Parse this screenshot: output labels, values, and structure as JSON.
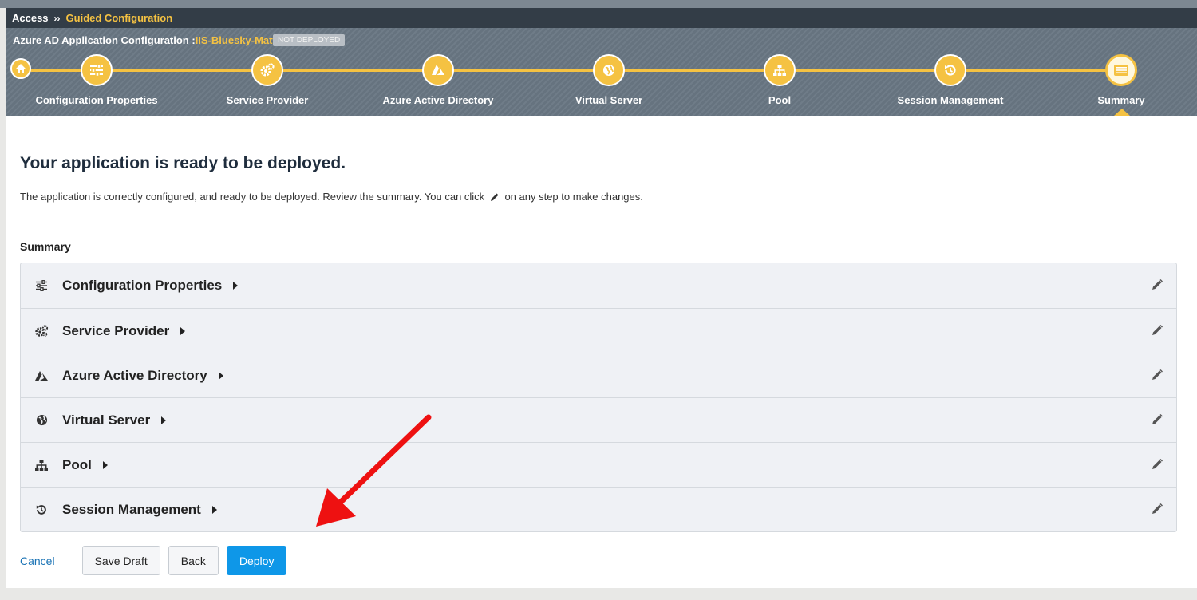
{
  "breadcrumb": {
    "root": "Access",
    "separator": "››",
    "current": "Guided Configuration"
  },
  "wizard": {
    "title_prefix": "Azure AD Application Configuration :",
    "app_name": "IIS-Bluesky-Matt",
    "status": "NOT DEPLOYED",
    "steps": [
      {
        "label": "Configuration Properties",
        "icon": "sliders-icon"
      },
      {
        "label": "Service Provider",
        "icon": "gears-icon"
      },
      {
        "label": "Azure Active Directory",
        "icon": "azure-icon"
      },
      {
        "label": "Virtual Server",
        "icon": "globe-icon"
      },
      {
        "label": "Pool",
        "icon": "sitemap-icon"
      },
      {
        "label": "Session Management",
        "icon": "history-icon"
      },
      {
        "label": "Summary",
        "icon": "list-icon"
      }
    ],
    "active_step": "Summary"
  },
  "main": {
    "headline": "Your application is ready to be deployed.",
    "desc_before": "The application is correctly configured, and ready to be deployed. Review the summary. You can click",
    "desc_after": "on any step to make changes.",
    "summary_label": "Summary",
    "summary_items": [
      {
        "label": "Configuration Properties",
        "icon": "sliders-icon"
      },
      {
        "label": "Service Provider",
        "icon": "gears-icon"
      },
      {
        "label": "Azure Active Directory",
        "icon": "azure-icon"
      },
      {
        "label": "Virtual Server",
        "icon": "globe-icon"
      },
      {
        "label": "Pool",
        "icon": "sitemap-icon"
      },
      {
        "label": "Session Management",
        "icon": "history-icon"
      }
    ]
  },
  "actions": {
    "cancel": "Cancel",
    "save_draft": "Save Draft",
    "back": "Back",
    "deploy": "Deploy"
  },
  "colors": {
    "accent": "#f5c242",
    "header_dark": "#333d47",
    "primary_button": "#0e97e8",
    "annotation_arrow": "#ee1111"
  }
}
